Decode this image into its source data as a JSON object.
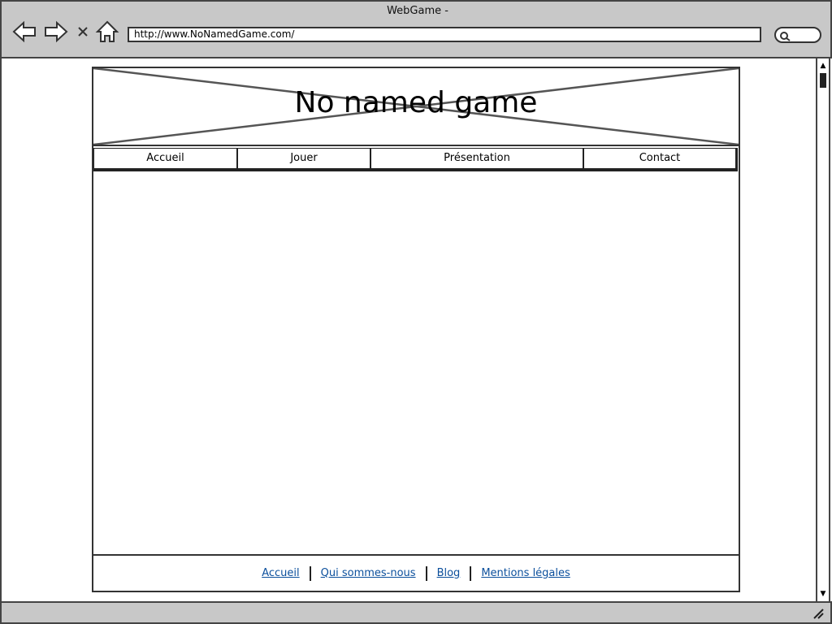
{
  "window": {
    "title": "WebGame -",
    "url": "http://www.NoNamedGame.com/"
  },
  "toolbar": {
    "icons": [
      "back-arrow-icon",
      "forward-arrow-icon",
      "stop-icon",
      "home-icon",
      "search-icon"
    ]
  },
  "site": {
    "banner_title": "No named game",
    "nav": [
      "Accueil",
      "Jouer",
      "Présentation",
      "Contact"
    ],
    "footer_links": [
      "Accueil",
      "Qui sommes-nous",
      "Blog",
      "Mentions légales"
    ]
  },
  "colors": {
    "chrome": "#c8c8c8",
    "link": "#0b4f9c"
  }
}
